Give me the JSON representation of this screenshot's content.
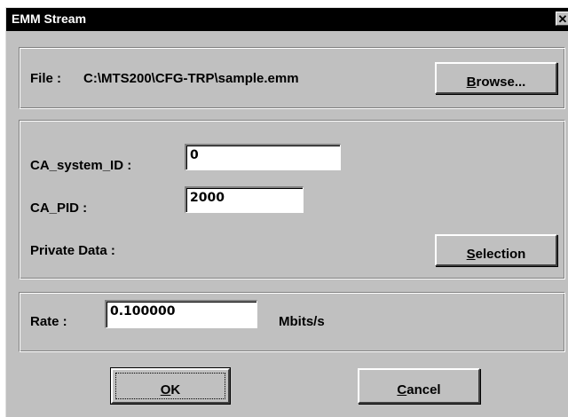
{
  "window": {
    "title": "EMM Stream",
    "close_glyph": "✕"
  },
  "file_group": {
    "label": "File :",
    "path": "C:\\MTS200\\CFG-TRP\\sample.emm",
    "browse": {
      "prefix": "",
      "accel": "B",
      "rest": "rowse..."
    }
  },
  "ca_group": {
    "system_id_label": "CA_system_ID :",
    "system_id_value": "0",
    "pid_label": "CA_PID :",
    "pid_value": "2000",
    "private_data_label": "Private Data :",
    "selection": {
      "accel": "S",
      "rest": "election"
    }
  },
  "rate_group": {
    "label": "Rate :",
    "value": "0.100000",
    "unit": "Mbits/s"
  },
  "buttons": {
    "ok": {
      "accel": "O",
      "rest": "K"
    },
    "cancel": {
      "accel": "C",
      "rest": "ancel"
    }
  }
}
